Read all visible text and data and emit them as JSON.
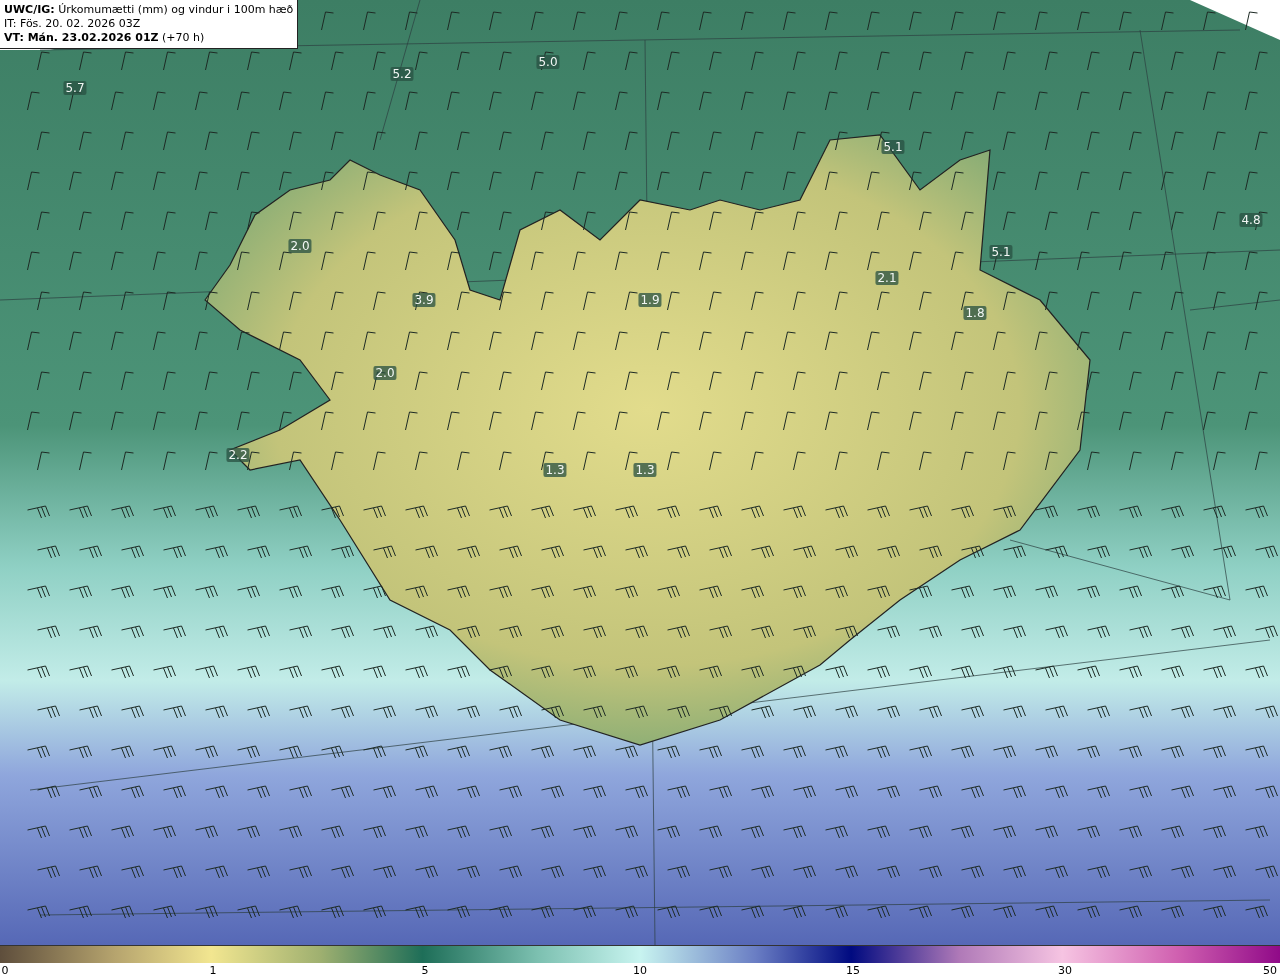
{
  "header": {
    "title": "**UWC/IG:** Úrkomumætti (mm) og vindur i 100m hæð",
    "issue_time": "IT: Fös. 20. 02. 2026 03Z",
    "valid_time": "**VT: Mán. 23.02.2026 01Z** (+70 h)"
  },
  "map_values": [
    "5.7",
    "5.2",
    "5.0",
    "5.1",
    "4.8",
    "5.1",
    "2.0",
    "3.9",
    "1.9",
    "2.0",
    "2.2",
    "1.3",
    "1.3",
    "2.1",
    "1.8"
  ],
  "colorbar": {
    "ticks": [
      "0",
      "1",
      "5",
      "10",
      "15",
      "30",
      "50"
    ]
  }
}
